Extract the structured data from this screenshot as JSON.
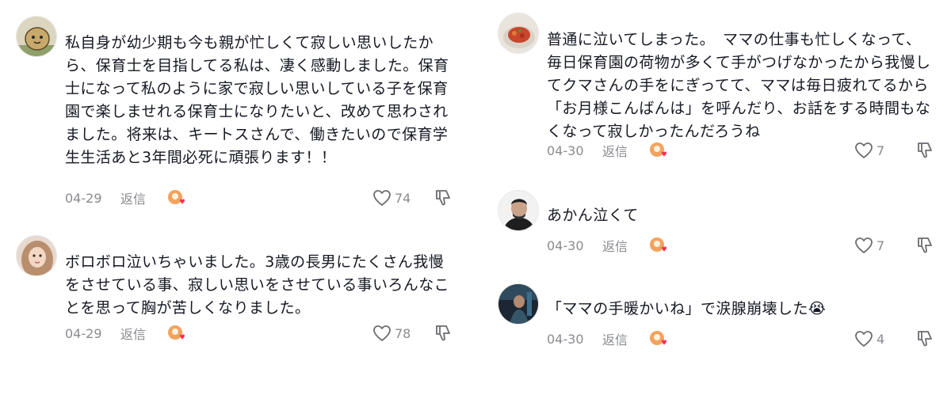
{
  "left_comments": [
    {
      "avatar_icon": "cartoon-character-avatar",
      "text": "私自身が幼少期も今も親が忙しくて寂しい思いしたから、保育士を目指してる私は、凄く感動しました。保育士になって私のように家で寂しい思いしている子を保育園で楽しませれる保育士になりたいと、改めて思わされました。将来は、キートスさんで、働きたいので保育学生生活あと3年間必死に頑張ります！！",
      "date": "04-29",
      "reply_label": "返信",
      "likes": "74"
    },
    {
      "avatar_icon": "woman-portrait-avatar",
      "text": "ボロボロ泣いちゃいました。3歳の長男にたくさん我慢をさせている事、寂しい思いをさせている事いろんなことを思って胸が苦しくなりました。",
      "date": "04-29",
      "reply_label": "返信",
      "likes": "78"
    }
  ],
  "right_comments": [
    {
      "avatar_icon": "food-photo-avatar",
      "text": "普通に泣いてしまった。　ママの仕事も忙しくなって、毎日保育園の荷物が多くて手がつげなかったから我慢してクマさんの手をにぎってて、ママは毎日疲れてるから「お月様こんばんは」を呼んだり、お話をする時間もなくなって寂しかったんだろうね",
      "date": "04-30",
      "reply_label": "返信",
      "likes": "7"
    },
    {
      "avatar_icon": "man-portrait-avatar",
      "text": "あかん泣くて",
      "date": "04-30",
      "reply_label": "返信",
      "likes": "7"
    },
    {
      "avatar_icon": "person-photo-avatar",
      "text": "「ママの手暖かいね」で涙腺崩壊した😭",
      "date": "04-30",
      "reply_label": "返信",
      "likes": "4"
    }
  ],
  "colors": {
    "text": "#161823",
    "meta": "#8a8b91",
    "heart_badge": "#fe2c55",
    "creator_badge": "#f5a25d"
  }
}
